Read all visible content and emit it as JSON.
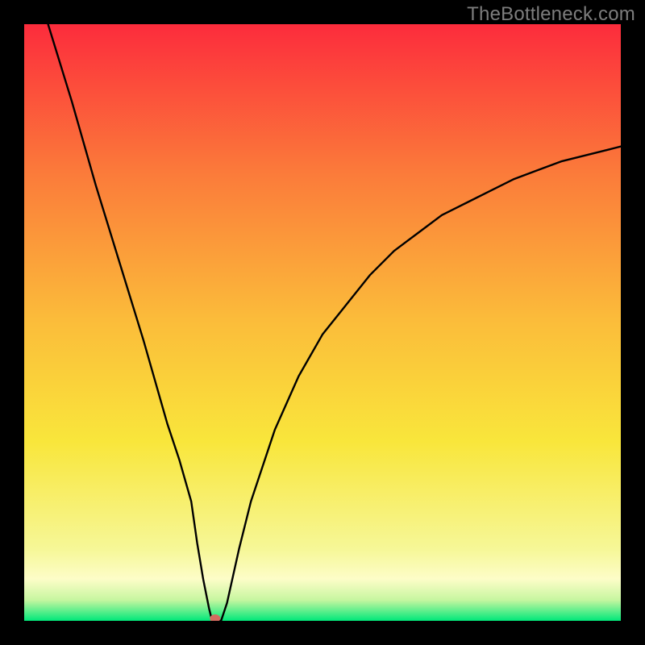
{
  "watermark": "TheBottleneck.com",
  "chart_data": {
    "type": "line",
    "title": "",
    "xlabel": "",
    "ylabel": "",
    "xlim": [
      0,
      100
    ],
    "ylim": [
      0,
      100
    ],
    "grid": false,
    "series": [
      {
        "name": "curve",
        "x": [
          4,
          8,
          12,
          16,
          20,
          24,
          26,
          28,
          29,
          30,
          31,
          31.5,
          32,
          33,
          34,
          36,
          38,
          42,
          46,
          50,
          54,
          58,
          62,
          66,
          70,
          74,
          78,
          82,
          86,
          90,
          94,
          98,
          100
        ],
        "y": [
          100,
          87,
          73,
          60,
          47,
          33,
          27,
          20,
          13,
          7,
          2,
          0,
          0,
          0,
          3,
          12,
          20,
          32,
          41,
          48,
          53,
          58,
          62,
          65,
          68,
          70,
          72,
          74,
          75.5,
          77,
          78,
          79,
          79.5
        ]
      }
    ],
    "marker": {
      "x": 32,
      "y": 0,
      "color": "#d46a5f"
    },
    "colors": {
      "curve": "#000000",
      "gradient_top": "#fc2c3c",
      "gradient_mid": "#f9e63b",
      "gradient_bottom": "#00e87a",
      "near_bottom_band": "#fdfdc8"
    }
  }
}
